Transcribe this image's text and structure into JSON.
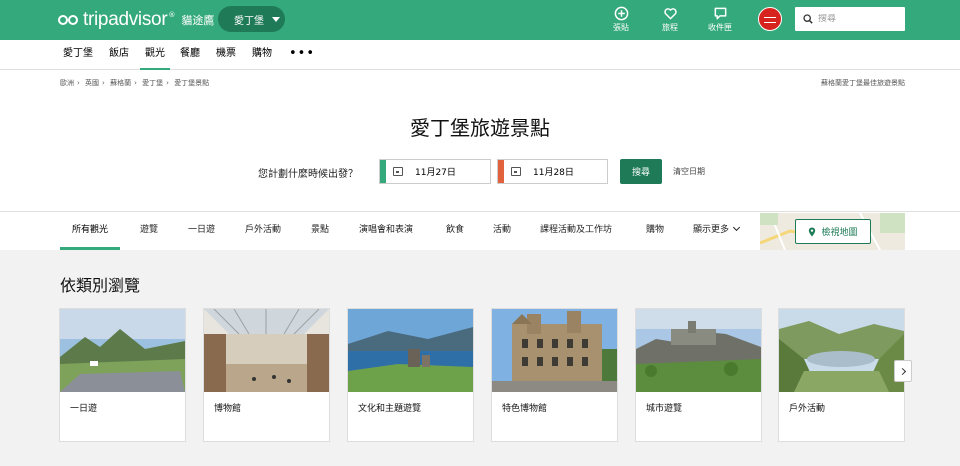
{
  "brand": {
    "name": "tripadvisor",
    "cn_name": "貓途鷹",
    "reg_mark": "®"
  },
  "header": {
    "location": "愛丁堡",
    "icons": [
      {
        "label": "張貼",
        "icon": "plus-circle-icon"
      },
      {
        "label": "旅程",
        "icon": "heart-icon"
      },
      {
        "label": "收件匣",
        "icon": "chat-icon"
      }
    ],
    "search_placeholder": "搜尋"
  },
  "subnav": {
    "items": [
      "愛丁堡",
      "飯店",
      "觀光",
      "餐廳",
      "機票",
      "購物"
    ],
    "active": "觀光",
    "more": "•••"
  },
  "breadcrumb": {
    "items": [
      "歐洲",
      "英國",
      "蘇格蘭",
      "愛丁堡",
      "愛丁堡景點"
    ],
    "right": "蘇格蘭愛丁堡最佳旅遊景點"
  },
  "page_title": "愛丁堡旅遊景點",
  "dates": {
    "question": "您計劃什麼時候出發？",
    "checkin": "11月27日",
    "checkout": "11月28日",
    "search": "搜尋",
    "clear": "清空日期",
    "checkin_color": "#34a97c",
    "checkout_color": "#e2623e"
  },
  "categories": {
    "items": [
      "所有觀光",
      "遊覽",
      "一日遊",
      "戶外活動",
      "景點",
      "演唱會和表演",
      "飲食",
      "活動",
      "課程活動及工作坊",
      "購物",
      "顯示更多"
    ],
    "active": "所有觀光",
    "map_button": "檢視地圖"
  },
  "browse": {
    "title": "依類別瀏覽",
    "cards": [
      {
        "label": "一日遊",
        "scene": "highlands"
      },
      {
        "label": "博物館",
        "scene": "museum-hall"
      },
      {
        "label": "文化和主題遊覽",
        "scene": "loch-castle"
      },
      {
        "label": "特色博物館",
        "scene": "historic-building"
      },
      {
        "label": "城市遊覽",
        "scene": "castle-hill"
      },
      {
        "label": "戶外活動",
        "scene": "valley-loch"
      }
    ]
  },
  "colors": {
    "brand_green": "#34a97c",
    "dark_green": "#1e7a57",
    "avatar_red": "#d6231d"
  }
}
